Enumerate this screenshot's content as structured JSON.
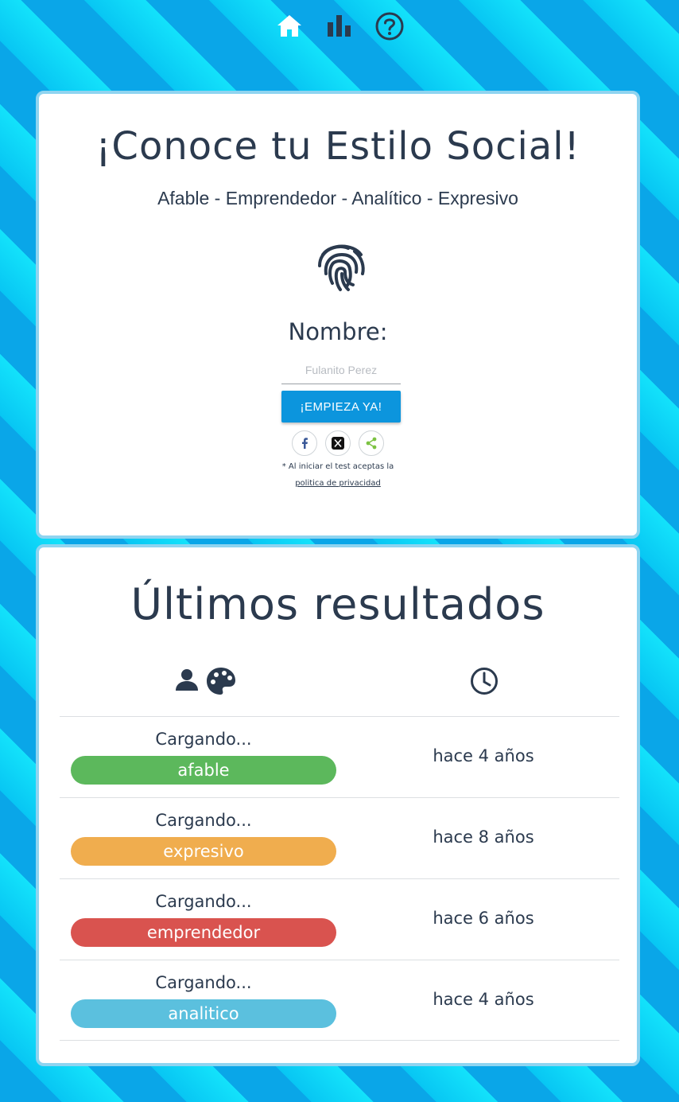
{
  "nav": {
    "items": [
      {
        "icon": "home-icon"
      },
      {
        "icon": "bar-chart-icon"
      },
      {
        "icon": "help-circle-icon"
      }
    ]
  },
  "intro": {
    "title": "¡Conoce tu Estilo Social!",
    "subtitle": "Afable - Emprendedor - Analítico - Expresivo",
    "icon": "fingerprint-icon",
    "name_label": "Nombre:",
    "name_placeholder": "Fulanito Perez",
    "name_value": "",
    "start_label": "¡EMPIEZA YA!",
    "share": [
      {
        "icon": "facebook-icon"
      },
      {
        "icon": "x-twitter-icon"
      },
      {
        "icon": "share-icon"
      }
    ],
    "terms_text": "* Al iniciar el test aceptas la",
    "privacy_link": "politica de privacidad"
  },
  "results": {
    "title": "Últimos resultados",
    "header_icons": [
      "user-icon",
      "palette-icon",
      "clock-icon"
    ],
    "rows": [
      {
        "name": "Cargando...",
        "style": "afable",
        "time": "hace 4 años"
      },
      {
        "name": "Cargando...",
        "style": "expresivo",
        "time": "hace 8 años"
      },
      {
        "name": "Cargando...",
        "style": "emprendedor",
        "time": "hace 6 años"
      },
      {
        "name": "Cargando...",
        "style": "analitico",
        "time": "hace 4 años"
      }
    ]
  },
  "colors": {
    "afable": "#5cb85c",
    "expresivo": "#f0ad4e",
    "emprendedor": "#d9534f",
    "analitico": "#5bc0de",
    "primary": "#0c95dd",
    "text": "#2b3a4e"
  }
}
